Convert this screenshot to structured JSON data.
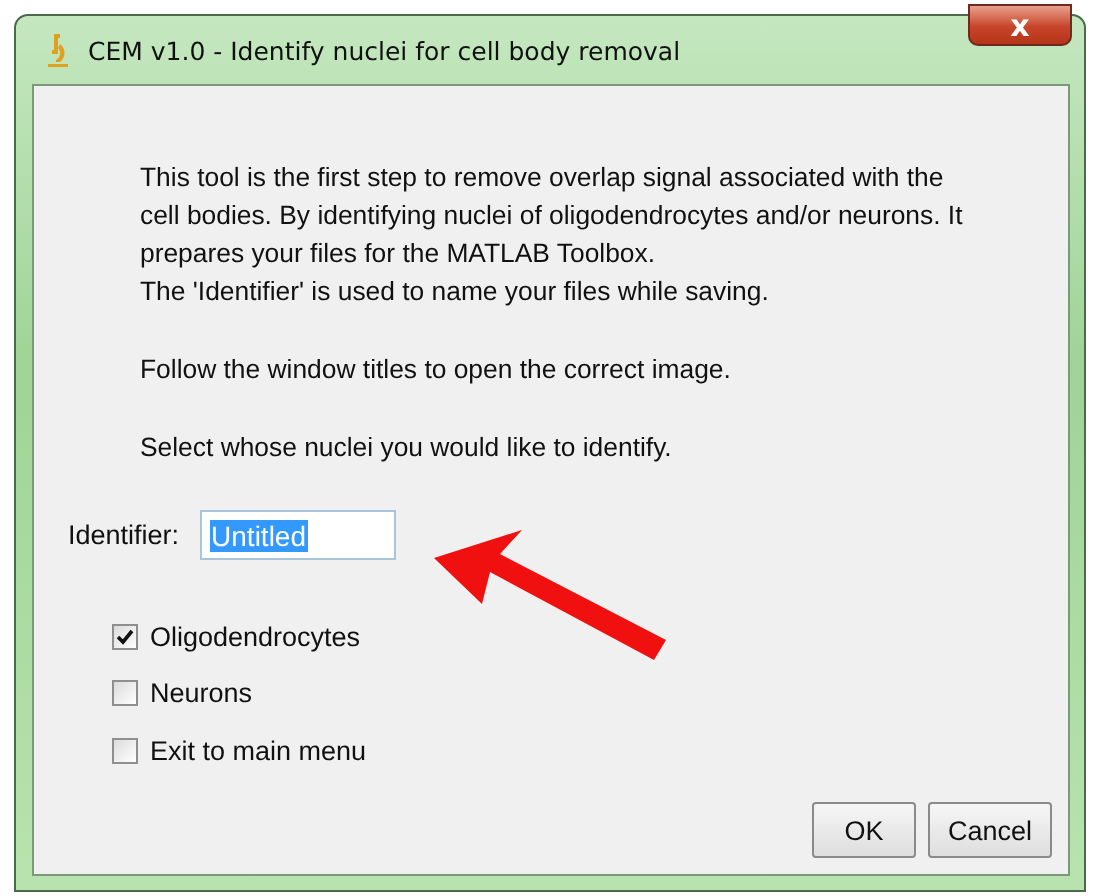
{
  "window": {
    "title": "CEM v1.0 - Identify nuclei for cell body removal",
    "close": "x"
  },
  "paragraphs": [
    [
      "This tool is the first step to remove overlap signal associated with the",
      "cell bodies. By identifying nuclei of oligodendrocytes and/or neurons. It",
      "prepares your files for the MATLAB Toolbox.",
      "The 'Identifier' is used to name your files while saving."
    ],
    [
      "Follow the window titles to open the correct image."
    ],
    [
      "Select whose nuclei you would like to identify."
    ]
  ],
  "identifier": {
    "label": "Identifier:",
    "value": "Untitled",
    "selected": true
  },
  "options": [
    {
      "label": "Oligodendrocytes",
      "checked": true
    },
    {
      "label": "Neurons",
      "checked": false
    },
    {
      "label": "Exit to main menu",
      "checked": false
    }
  ],
  "buttons": [
    "OK",
    "Cancel"
  ]
}
